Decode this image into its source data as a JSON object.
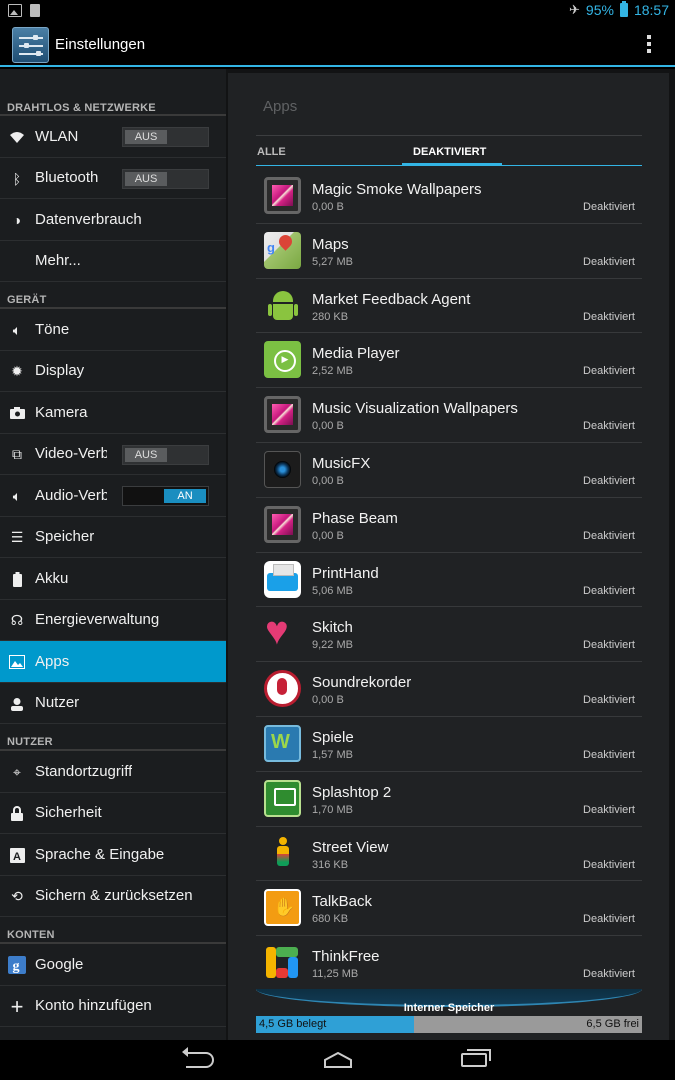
{
  "status_bar": {
    "battery_percent": "95%",
    "time": "18:57"
  },
  "action_bar": {
    "title": "Einstellungen"
  },
  "sidebar": {
    "sections": {
      "wireless": "DRAHTLOS & NETZWERKE",
      "device": "GERÄT",
      "user": "NUTZER",
      "accounts": "KONTEN"
    },
    "items": {
      "wlan": "WLAN",
      "bluetooth": "Bluetooth",
      "data_usage": "Datenverbrauch",
      "more": "Mehr...",
      "sound": "Töne",
      "display": "Display",
      "camera": "Kamera",
      "video_out": "Video-Verb",
      "audio_out": "Audio-Verb",
      "storage": "Speicher",
      "battery": "Akku",
      "power": "Energieverwaltung",
      "apps": "Apps",
      "users": "Nutzer",
      "location": "Standortzugriff",
      "security": "Sicherheit",
      "language": "Sprache & Eingabe",
      "backup": "Sichern & zurücksetzen",
      "google": "Google",
      "add_account": "Konto hinzufügen"
    },
    "toggles": {
      "wlan": "AUS",
      "bluetooth": "AUS",
      "video_out": "AUS",
      "audio_out": "AN"
    }
  },
  "main": {
    "title": "Apps",
    "tabs": {
      "all": "ALLE",
      "disabled": "DEAKTIVIERT"
    },
    "apps": [
      {
        "name": "Magic Smoke Wallpapers",
        "size": "0,00 B",
        "status": "Deaktiviert",
        "icon": "wallpaper-icon"
      },
      {
        "name": "Maps",
        "size": "5,27 MB",
        "status": "Deaktiviert",
        "icon": "maps-icon"
      },
      {
        "name": "Market Feedback Agent",
        "size": "280 KB",
        "status": "Deaktiviert",
        "icon": "android-icon"
      },
      {
        "name": "Media Player",
        "size": "2,52 MB",
        "status": "Deaktiviert",
        "icon": "media-player-icon"
      },
      {
        "name": "Music Visualization Wallpapers",
        "size": "0,00 B",
        "status": "Deaktiviert",
        "icon": "wallpaper-icon"
      },
      {
        "name": "MusicFX",
        "size": "0,00 B",
        "status": "Deaktiviert",
        "icon": "speaker-icon"
      },
      {
        "name": "Phase Beam",
        "size": "0,00 B",
        "status": "Deaktiviert",
        "icon": "wallpaper-icon"
      },
      {
        "name": "PrintHand",
        "size": "5,06 MB",
        "status": "Deaktiviert",
        "icon": "printer-icon"
      },
      {
        "name": "Skitch",
        "size": "9,22 MB",
        "status": "Deaktiviert",
        "icon": "skitch-heart-icon"
      },
      {
        "name": "Soundrekorder",
        "size": "0,00 B",
        "status": "Deaktiviert",
        "icon": "microphone-icon"
      },
      {
        "name": "Spiele",
        "size": "1,57 MB",
        "status": "Deaktiviert",
        "icon": "games-icon"
      },
      {
        "name": "Splashtop 2",
        "size": "1,70 MB",
        "status": "Deaktiviert",
        "icon": "splashtop-icon"
      },
      {
        "name": "Street View",
        "size": "316 KB",
        "status": "Deaktiviert",
        "icon": "pegman-icon"
      },
      {
        "name": "TalkBack",
        "size": "680 KB",
        "status": "Deaktiviert",
        "icon": "talkback-hand-icon"
      },
      {
        "name": "ThinkFree",
        "size": "11,25 MB",
        "status": "Deaktiviert",
        "icon": "thinkfree-icon"
      }
    ],
    "storage": {
      "label": "Interner Speicher",
      "used": "4,5 GB belegt",
      "free": "6,5 GB frei",
      "used_fraction": 0.41
    }
  },
  "colors": {
    "accent": "#33b5e5",
    "selected_item": "#0099cc"
  }
}
